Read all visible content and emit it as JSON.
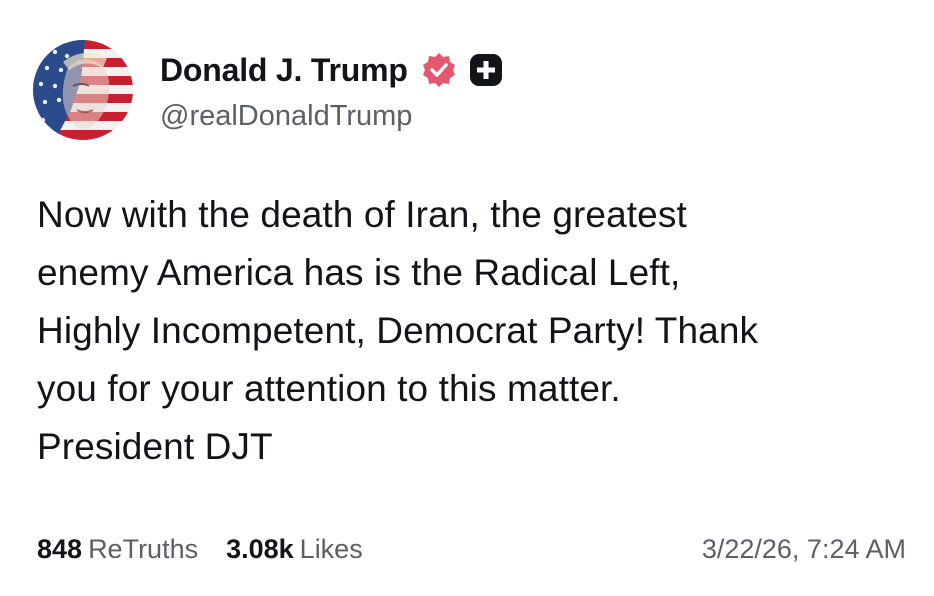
{
  "colors": {
    "verified_badge": "#e4576f",
    "plus_badge": "#111418",
    "muted_text": "#5b6068",
    "primary_text": "#111418"
  },
  "author": {
    "display_name": "Donald J. Trump",
    "handle": "@realDonaldTrump",
    "verified_icon": "verified-badge-icon",
    "plus_icon": "plus-badge-icon"
  },
  "post": {
    "lines": [
      "Now with the death of Iran, the greatest",
      "enemy America has is the Radical Left,",
      "Highly Incompetent, Democrat Party! Thank",
      "you for your attention to this matter.",
      "President DJT"
    ]
  },
  "stats": {
    "retruths_count": "848",
    "retruths_label": "ReTruths",
    "likes_count": "3.08k",
    "likes_label": "Likes"
  },
  "timestamp": "3/22/26, 7:24 AM"
}
